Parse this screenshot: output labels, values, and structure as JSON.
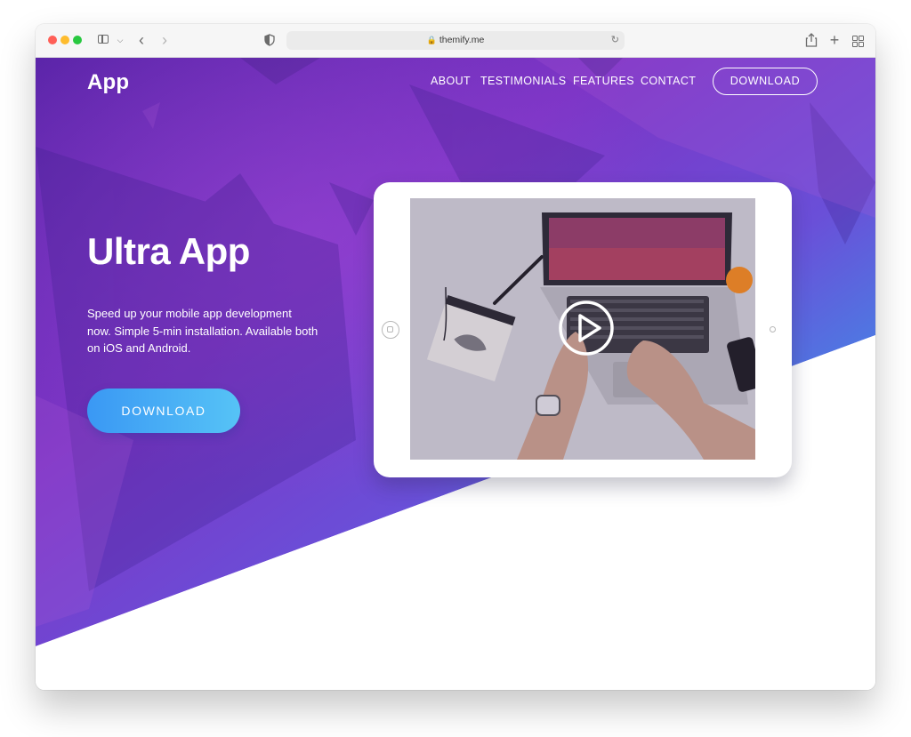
{
  "browser": {
    "url": "themify.me",
    "icons": [
      "sidebar-icon",
      "chevron-down-icon",
      "back-icon",
      "forward-icon",
      "shield-icon",
      "lock-icon",
      "reload-icon",
      "share-icon",
      "plus-icon",
      "tab-grid-icon"
    ]
  },
  "nav": {
    "logo": "App",
    "links": [
      "ABOUT",
      "TESTIMONIALS",
      "FEATURES",
      "CONTACT"
    ],
    "download": "DOWNLOAD"
  },
  "hero": {
    "title": "Ultra App",
    "description": "Speed up your mobile app development now. Simple 5-min installation. Available both on iOS and Android.",
    "cta": "DOWNLOAD"
  },
  "media": {
    "play_icon": "play-icon"
  },
  "colors": {
    "hero_purple": "#7a32c4",
    "hero_blue": "#3b9cf0",
    "cta_start": "#3a98f4",
    "cta_end": "#56c3f6",
    "text": "#ffffff"
  }
}
